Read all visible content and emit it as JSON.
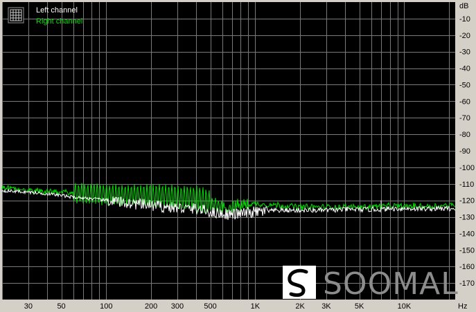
{
  "chart_data": {
    "type": "line",
    "title": "",
    "x_unit": "Hz",
    "y_unit": "dB",
    "x_scale": "log",
    "xlim": [
      20,
      22000
    ],
    "ylim": [
      -180,
      0
    ],
    "grid": true,
    "legend_position": "top-left",
    "x_ticks": [
      {
        "value": 30,
        "label": "30"
      },
      {
        "value": 50,
        "label": "50"
      },
      {
        "value": 100,
        "label": "100"
      },
      {
        "value": 200,
        "label": "200"
      },
      {
        "value": 300,
        "label": "300"
      },
      {
        "value": 500,
        "label": "500"
      },
      {
        "value": 1000,
        "label": "1K"
      },
      {
        "value": 2000,
        "label": "2K"
      },
      {
        "value": 3000,
        "label": "3K"
      },
      {
        "value": 5000,
        "label": "5K"
      },
      {
        "value": 10000,
        "label": "10K"
      }
    ],
    "y_ticks": [
      -10,
      -20,
      -30,
      -40,
      -50,
      -60,
      -70,
      -80,
      -90,
      -100,
      -110,
      -120,
      -130,
      -140,
      -150,
      -160,
      -170
    ],
    "series": [
      {
        "name": "Left channel",
        "color": "#ffffff",
        "points": [
          [
            20,
            -114
          ],
          [
            30,
            -115
          ],
          [
            40,
            -116
          ],
          [
            50,
            -117
          ],
          [
            60,
            -118
          ],
          [
            70,
            -118.5
          ],
          [
            80,
            -119
          ],
          [
            100,
            -120
          ],
          [
            120,
            -121
          ],
          [
            150,
            -122
          ],
          [
            200,
            -123
          ],
          [
            250,
            -124
          ],
          [
            300,
            -124.5
          ],
          [
            350,
            -125
          ],
          [
            400,
            -125
          ],
          [
            500,
            -127
          ],
          [
            600,
            -128
          ],
          [
            700,
            -128.5
          ],
          [
            800,
            -128
          ],
          [
            1000,
            -127
          ],
          [
            1500,
            -126
          ],
          [
            2000,
            -126
          ],
          [
            3000,
            -126
          ],
          [
            4000,
            -125.5
          ],
          [
            5000,
            -125.5
          ],
          [
            6000,
            -125.5
          ],
          [
            7000,
            -125.5
          ],
          [
            8000,
            -125
          ],
          [
            10000,
            -125
          ],
          [
            15000,
            -125
          ],
          [
            20000,
            -125
          ],
          [
            22000,
            -125
          ]
        ]
      },
      {
        "name": "Right channel",
        "color": "#00e000",
        "points": [
          [
            20,
            -112
          ],
          [
            30,
            -114
          ],
          [
            40,
            -114.5
          ],
          [
            50,
            -115
          ],
          [
            60,
            -115.5
          ],
          [
            70,
            -116
          ],
          [
            80,
            -116
          ],
          [
            100,
            -116.5
          ],
          [
            150,
            -117
          ],
          [
            200,
            -117
          ],
          [
            250,
            -117.5
          ],
          [
            300,
            -118
          ],
          [
            350,
            -118.5
          ],
          [
            400,
            -119
          ],
          [
            450,
            -120
          ],
          [
            500,
            -122
          ],
          [
            600,
            -124
          ],
          [
            700,
            -124
          ],
          [
            800,
            -123
          ],
          [
            1000,
            -122
          ],
          [
            1500,
            -123
          ],
          [
            2000,
            -124
          ],
          [
            3000,
            -124
          ],
          [
            5000,
            -124
          ],
          [
            7000,
            -123.5
          ],
          [
            10000,
            -123.5
          ],
          [
            15000,
            -123.5
          ],
          [
            20000,
            -123
          ],
          [
            22000,
            -123
          ]
        ]
      }
    ],
    "spikes": [
      {
        "series": "Left channel",
        "x": 7000,
        "y": -120
      }
    ]
  },
  "watermark": {
    "brand": "SOOMAL"
  },
  "icons": {
    "legend": "grid-icon"
  }
}
